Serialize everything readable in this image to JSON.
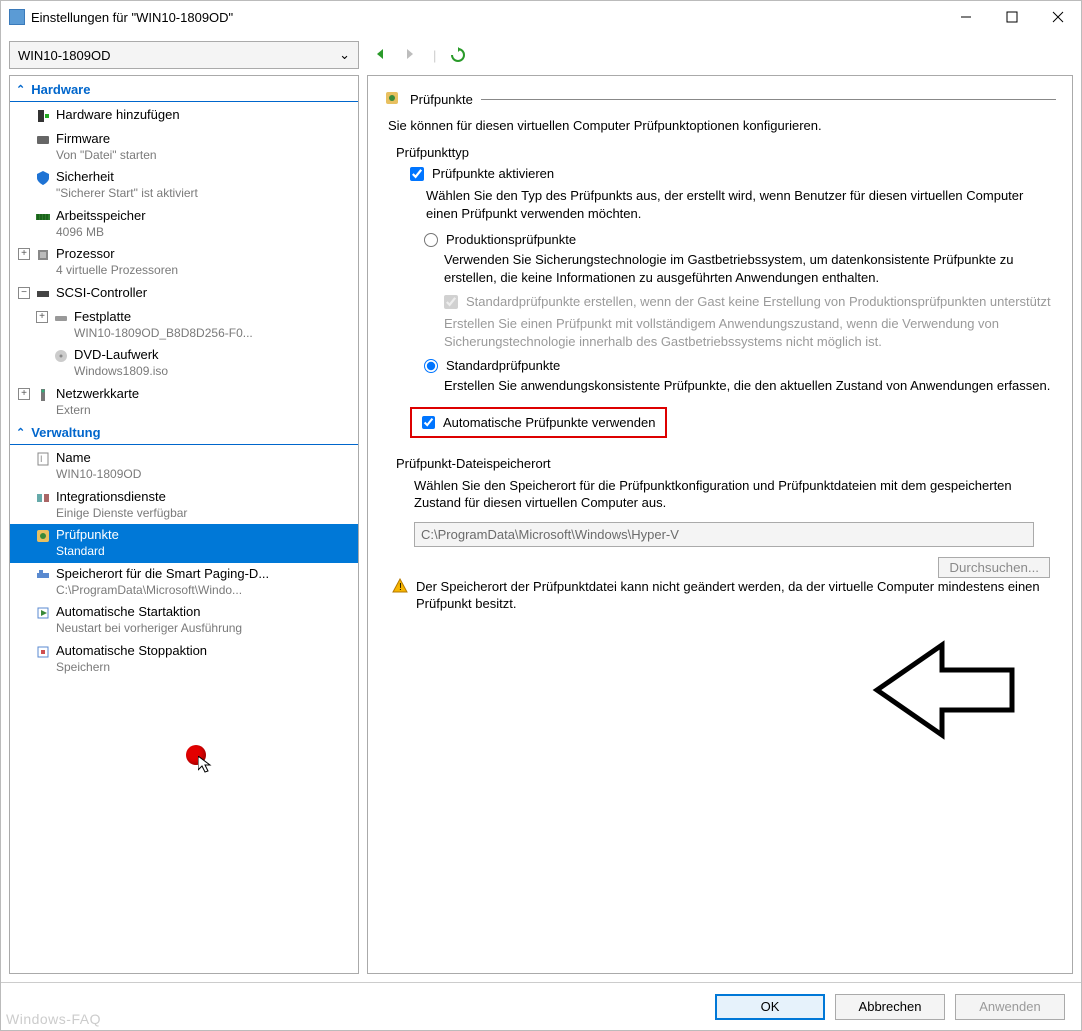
{
  "window": {
    "title": "Einstellungen für \"WIN10-1809OD\""
  },
  "vm_dropdown": "WIN10-1809OD",
  "sections": {
    "hardware": {
      "title": "Hardware",
      "items": [
        {
          "label": "Hardware hinzufügen",
          "sub": ""
        },
        {
          "label": "Firmware",
          "sub": "Von \"Datei\" starten"
        },
        {
          "label": "Sicherheit",
          "sub": "\"Sicherer Start\" ist aktiviert"
        },
        {
          "label": "Arbeitsspeicher",
          "sub": "4096 MB"
        },
        {
          "label": "Prozessor",
          "sub": "4 virtuelle Prozessoren",
          "exp": "+"
        },
        {
          "label": "SCSI-Controller",
          "sub": "",
          "exp": "−"
        },
        {
          "label": "Festplatte",
          "sub": "WIN10-1809OD_B8D8D256-F0...",
          "exp": "+",
          "indent": 2
        },
        {
          "label": "DVD-Laufwerk",
          "sub": "Windows1809.iso",
          "indent": 2
        },
        {
          "label": "Netzwerkkarte",
          "sub": "Extern",
          "exp": "+"
        }
      ]
    },
    "verwaltung": {
      "title": "Verwaltung",
      "items": [
        {
          "label": "Name",
          "sub": "WIN10-1809OD"
        },
        {
          "label": "Integrationsdienste",
          "sub": "Einige Dienste verfügbar"
        },
        {
          "label": "Prüfpunkte",
          "sub": "Standard",
          "selected": true
        },
        {
          "label": "Speicherort für die Smart Paging-D...",
          "sub": "C:\\ProgramData\\Microsoft\\Windo..."
        },
        {
          "label": "Automatische Startaktion",
          "sub": "Neustart bei vorheriger Ausführung"
        },
        {
          "label": "Automatische Stoppaktion",
          "sub": "Speichern"
        }
      ]
    }
  },
  "detail": {
    "header": "Prüfpunkte",
    "intro": "Sie können für diesen virtuellen Computer Prüfpunktoptionen konfigurieren.",
    "group1_title": "Prüfpunkttyp",
    "enable_checkpoints": "Prüfpunkte aktivieren",
    "choose_type_help": "Wählen Sie den Typ des Prüfpunkts aus, der erstellt wird, wenn Benutzer für diesen virtuellen Computer einen Prüfpunkt verwenden möchten.",
    "radio_prod": "Produktionsprüfpunkte",
    "radio_prod_help": "Verwenden Sie Sicherungstechnologie im Gastbetriebssystem, um datenkonsistente Prüfpunkte zu erstellen, die keine Informationen zu ausgeführten Anwendungen enthalten.",
    "fallback_chk": "Standardprüfpunkte erstellen, wenn der Gast keine Erstellung von Produktionsprüfpunkten unterstützt",
    "fallback_help": "Erstellen Sie einen Prüfpunkt mit vollständigem Anwendungszustand, wenn die Verwendung von Sicherungstechnologie innerhalb des Gastbetriebssystems nicht möglich ist.",
    "radio_std": "Standardprüfpunkte",
    "radio_std_help": "Erstellen Sie anwendungskonsistente Prüfpunkte, die den aktuellen Zustand von Anwendungen erfassen.",
    "auto_chk": "Automatische Prüfpunkte verwenden",
    "group2_title": "Prüfpunkt-Dateispeicherort",
    "group2_help": "Wählen Sie den Speicherort für die Prüfpunktkonfiguration und Prüfpunktdateien mit dem gespeicherten Zustand für diesen virtuellen Computer aus.",
    "path": "C:\\ProgramData\\Microsoft\\Windows\\Hyper-V",
    "browse": "Durchsuchen...",
    "warning": "Der Speicherort der Prüfpunktdatei kann nicht geändert werden, da der virtuelle Computer mindestens einen Prüfpunkt besitzt."
  },
  "footer": {
    "ok": "OK",
    "cancel": "Abbrechen",
    "apply": "Anwenden"
  },
  "watermark": "Windows-FAQ"
}
